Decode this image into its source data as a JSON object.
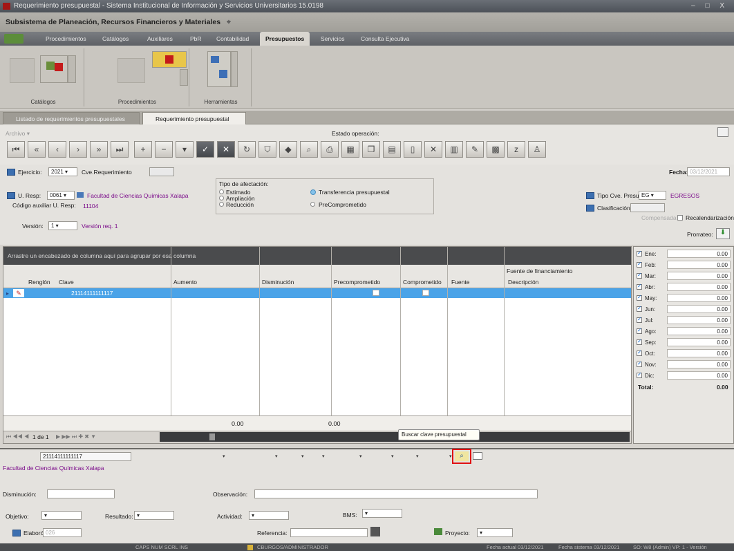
{
  "window": {
    "title": "Requerimiento presupuestal - Sistema Institucional de Información y Servicios Universitarios 15.0198",
    "controls": "– □ X"
  },
  "subsystem": {
    "title": "Subsistema de Planeación, Recursos Financieros y Materiales"
  },
  "menu": {
    "items": [
      "Procedimientos",
      "Catálogos",
      "Auxiliares",
      "PbR",
      "Contabilidad",
      "Presupuestos",
      "Servicios",
      "Consulta Ejecutiva"
    ],
    "active": "Presupuestos"
  },
  "ribbon": {
    "groups": [
      "Catálogos",
      "Procedimientos",
      "Herramientas"
    ]
  },
  "doc_tabs": {
    "tab1": "Listado de requerimientos presupuestales",
    "tab2": "Requerimiento presupuestal",
    "close": "x"
  },
  "toolbar": {
    "archivo": "Archivo ▾",
    "estado_label": "Estado operación:"
  },
  "form": {
    "ejercicio_label": "Ejercicio:",
    "ejercicio_value": "2021 ▾",
    "cve_req_label": "Cve.Requerimiento",
    "uresp_label": "U. Resp:",
    "uresp_value": "0061 ▾",
    "uresp_name": "Facultad de Ciencias Químicas Xalapa",
    "codaux_label": "Código auxiliar U. Resp:",
    "codaux_value": "11104",
    "version_label": "Versión:",
    "version_value": "1 ▾",
    "version_text": "Versión req. 1",
    "afect_title": "Tipo de afectación:",
    "afect_options": [
      "Estimado",
      "Ampliación",
      "Reducción"
    ],
    "transfer_label": "Transferencia presupuestal",
    "precomp_label": "PreComprometido",
    "fecha_label": "Fecha:",
    "fecha_value": "03/12/2021",
    "tipo_cve_label": "Tipo Cve. Presup.:",
    "tipo_cve_value": "EG ▾",
    "tipo_cve_name": "EGRESOS",
    "clasif_label": "Clasificación:",
    "compensada": "Compensada",
    "recal_label": "Recalendarización",
    "prorrateo_label": "Prorrateo:"
  },
  "grid": {
    "group_hint": "Arrastre un encabezado de columna aquí para agrupar por esa columna",
    "fuente_group": "Fuente de financiamiento",
    "columns": [
      "Renglón",
      "Clave",
      "Aumento",
      "Disminución",
      "Precomprometido",
      "Comprometido",
      "Fuente",
      "Descripción"
    ],
    "row_clave": "21114111111117",
    "total_aumento": "0.00",
    "total_disminucion": "0.00",
    "nav_text": "1 de 1"
  },
  "months": {
    "items": [
      {
        "label": "Ene:",
        "value": "0.00"
      },
      {
        "label": "Feb:",
        "value": "0.00"
      },
      {
        "label": "Mar:",
        "value": "0.00"
      },
      {
        "label": "Abr:",
        "value": "0.00"
      },
      {
        "label": "May:",
        "value": "0.00"
      },
      {
        "label": "Jun:",
        "value": "0.00"
      },
      {
        "label": "Jul:",
        "value": "0.00"
      },
      {
        "label": "Ago:",
        "value": "0.00"
      },
      {
        "label": "Sep:",
        "value": "0.00"
      },
      {
        "label": "Oct:",
        "value": "0.00"
      },
      {
        "label": "Nov:",
        "value": "0.00"
      },
      {
        "label": "Dic:",
        "value": "0.00"
      }
    ],
    "total_label": "Total:",
    "total_value": "0.00"
  },
  "bottom": {
    "clave": "21114111111117",
    "facultad": "Facultad de Ciencias Químicas Xalapa",
    "disminucion_label": "Disminución:",
    "observacion_label": "Observación:",
    "objetivo_label": "Objetivo:",
    "resultado_label": "Resultado:",
    "actividad_label": "Actividad:",
    "bms_label": "BMS:",
    "elaboro_label": "Elaboró:",
    "elaboro_value": "026",
    "referencia_label": "Referencia:",
    "proyecto_label": "Proyecto:",
    "tooltip": "Buscar clave presupuestal"
  },
  "status": {
    "keys": "CAPS NUM SCRL INS",
    "user": "CBURGOS/ADMINISTRADOR",
    "fecha_actual": "Fecha actual 03/12/2021",
    "fecha_sistema": "Fecha sistema 03/12/2021",
    "so": "SO: W8 (Admin) VP: 1 - Versión"
  }
}
